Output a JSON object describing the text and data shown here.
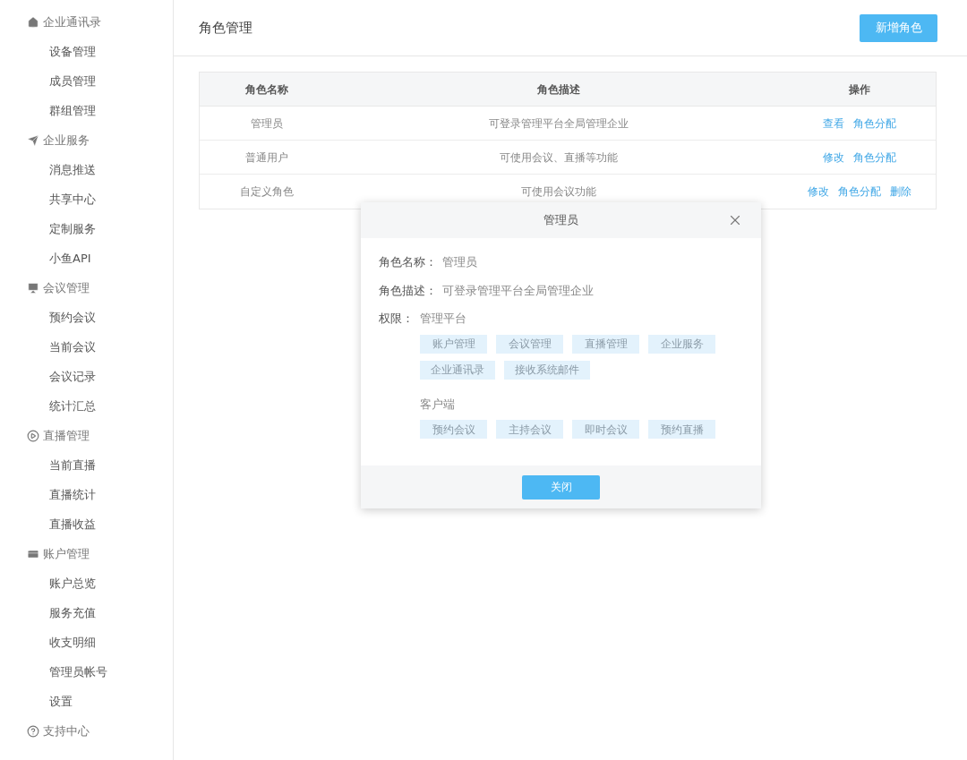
{
  "sidebar": {
    "groups": [
      {
        "label": "企业通讯录",
        "children": [
          {
            "label": "设备管理"
          },
          {
            "label": "成员管理"
          },
          {
            "label": "群组管理"
          }
        ]
      },
      {
        "label": "企业服务",
        "children": [
          {
            "label": "消息推送"
          },
          {
            "label": "共享中心"
          },
          {
            "label": "定制服务"
          },
          {
            "label": "小鱼API"
          }
        ]
      },
      {
        "label": "会议管理",
        "children": [
          {
            "label": "预约会议"
          },
          {
            "label": "当前会议"
          },
          {
            "label": "会议记录"
          },
          {
            "label": "统计汇总"
          }
        ]
      },
      {
        "label": "直播管理",
        "children": [
          {
            "label": "当前直播"
          },
          {
            "label": "直播统计"
          },
          {
            "label": "直播收益"
          }
        ]
      },
      {
        "label": "账户管理",
        "children": [
          {
            "label": "账户总览"
          },
          {
            "label": "服务充值"
          },
          {
            "label": "收支明细"
          },
          {
            "label": "管理员帐号"
          },
          {
            "label": "设置"
          }
        ]
      },
      {
        "label": "支持中心"
      }
    ]
  },
  "page": {
    "title": "角色管理",
    "add_button": "新增角色"
  },
  "table": {
    "columns": [
      "角色名称",
      "角色描述",
      "操作"
    ],
    "rows": [
      {
        "name": "管理员",
        "description": "可登录管理平台全局管理企业",
        "actions": [
          "查看",
          "角色分配"
        ]
      },
      {
        "name": "普通用户",
        "description": "可使用会议、直播等功能",
        "actions": [
          "修改",
          "角色分配"
        ]
      },
      {
        "name": "自定义角色",
        "description": "可使用会议功能",
        "actions": [
          "修改",
          "角色分配",
          "删除"
        ]
      }
    ]
  },
  "dialog": {
    "title": "管理员",
    "fields": [
      {
        "label": "角色名称：",
        "value": "管理员"
      },
      {
        "label": "角色描述：",
        "value": "可登录管理平台全局管理企业"
      }
    ],
    "permissions_label": "权限：",
    "permission_groups": [
      {
        "label": "管理平台",
        "tags": [
          "账户管理",
          "会议管理",
          "直播管理",
          "企业服务",
          "企业通讯录",
          "接收系统邮件"
        ]
      },
      {
        "label": "客户端",
        "tags": [
          "预约会议",
          "主持会议",
          "即时会议",
          "预约直播"
        ]
      }
    ],
    "close_button": "关闭"
  }
}
